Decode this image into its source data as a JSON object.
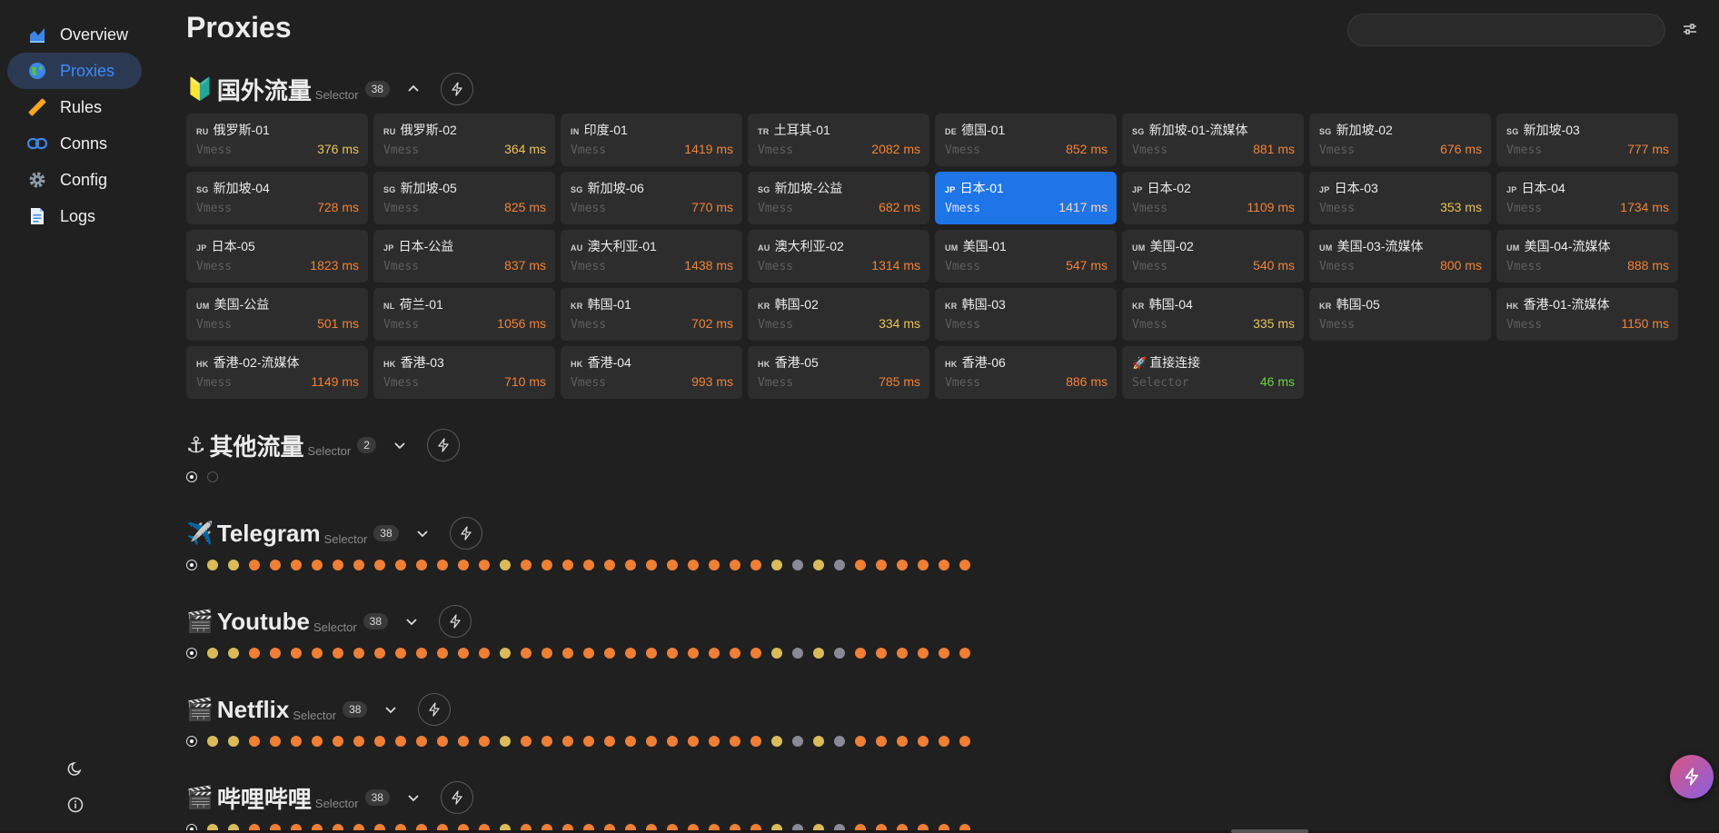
{
  "sidebar": {
    "items": [
      {
        "label": "Overview",
        "icon": "chart-icon"
      },
      {
        "label": "Proxies",
        "icon": "globe-icon"
      },
      {
        "label": "Rules",
        "icon": "ruler-icon"
      },
      {
        "label": "Conns",
        "icon": "link-icon"
      },
      {
        "label": "Config",
        "icon": "gear-icon"
      },
      {
        "label": "Logs",
        "icon": "document-icon"
      }
    ],
    "active": "Proxies"
  },
  "header": {
    "title": "Proxies",
    "search_placeholder": ""
  },
  "groups": [
    {
      "emoji": "🔰",
      "name": "国外流量",
      "type": "Selector",
      "count": "38",
      "expanded": true,
      "proxies": [
        {
          "flag": "RU",
          "name": "俄罗斯-01",
          "proto": "Vmess",
          "latency": "376 ms",
          "level": "mid"
        },
        {
          "flag": "RU",
          "name": "俄罗斯-02",
          "proto": "Vmess",
          "latency": "364 ms",
          "level": "mid"
        },
        {
          "flag": "IN",
          "name": "印度-01",
          "proto": "Vmess",
          "latency": "1419 ms",
          "level": "high"
        },
        {
          "flag": "TR",
          "name": "土耳其-01",
          "proto": "Vmess",
          "latency": "2082 ms",
          "level": "high"
        },
        {
          "flag": "DE",
          "name": "德国-01",
          "proto": "Vmess",
          "latency": "852 ms",
          "level": "high"
        },
        {
          "flag": "SG",
          "name": "新加坡-01-流媒体",
          "proto": "Vmess",
          "latency": "881 ms",
          "level": "high"
        },
        {
          "flag": "SG",
          "name": "新加坡-02",
          "proto": "Vmess",
          "latency": "676 ms",
          "level": "high"
        },
        {
          "flag": "SG",
          "name": "新加坡-03",
          "proto": "Vmess",
          "latency": "777 ms",
          "level": "high"
        },
        {
          "flag": "SG",
          "name": "新加坡-04",
          "proto": "Vmess",
          "latency": "728 ms",
          "level": "high"
        },
        {
          "flag": "SG",
          "name": "新加坡-05",
          "proto": "Vmess",
          "latency": "825 ms",
          "level": "high"
        },
        {
          "flag": "SG",
          "name": "新加坡-06",
          "proto": "Vmess",
          "latency": "770 ms",
          "level": "high"
        },
        {
          "flag": "SG",
          "name": "新加坡-公益",
          "proto": "Vmess",
          "latency": "682 ms",
          "level": "high"
        },
        {
          "flag": "JP",
          "name": "日本-01",
          "proto": "Vmess",
          "latency": "1417 ms",
          "level": "high",
          "selected": true
        },
        {
          "flag": "JP",
          "name": "日本-02",
          "proto": "Vmess",
          "latency": "1109 ms",
          "level": "high"
        },
        {
          "flag": "JP",
          "name": "日本-03",
          "proto": "Vmess",
          "latency": "353 ms",
          "level": "mid"
        },
        {
          "flag": "JP",
          "name": "日本-04",
          "proto": "Vmess",
          "latency": "1734 ms",
          "level": "high"
        },
        {
          "flag": "JP",
          "name": "日本-05",
          "proto": "Vmess",
          "latency": "1823 ms",
          "level": "high"
        },
        {
          "flag": "JP",
          "name": "日本-公益",
          "proto": "Vmess",
          "latency": "837 ms",
          "level": "high"
        },
        {
          "flag": "AU",
          "name": "澳大利亚-01",
          "proto": "Vmess",
          "latency": "1438 ms",
          "level": "high"
        },
        {
          "flag": "AU",
          "name": "澳大利亚-02",
          "proto": "Vmess",
          "latency": "1314 ms",
          "level": "high"
        },
        {
          "flag": "UM",
          "name": "美国-01",
          "proto": "Vmess",
          "latency": "547 ms",
          "level": "high"
        },
        {
          "flag": "UM",
          "name": "美国-02",
          "proto": "Vmess",
          "latency": "540 ms",
          "level": "high"
        },
        {
          "flag": "UM",
          "name": "美国-03-流媒体",
          "proto": "Vmess",
          "latency": "800 ms",
          "level": "high"
        },
        {
          "flag": "UM",
          "name": "美国-04-流媒体",
          "proto": "Vmess",
          "latency": "888 ms",
          "level": "high"
        },
        {
          "flag": "UM",
          "name": "美国-公益",
          "proto": "Vmess",
          "latency": "501 ms",
          "level": "high"
        },
        {
          "flag": "NL",
          "name": "荷兰-01",
          "proto": "Vmess",
          "latency": "1056 ms",
          "level": "high"
        },
        {
          "flag": "KR",
          "name": "韩国-01",
          "proto": "Vmess",
          "latency": "702 ms",
          "level": "high"
        },
        {
          "flag": "KR",
          "name": "韩国-02",
          "proto": "Vmess",
          "latency": "334 ms",
          "level": "mid"
        },
        {
          "flag": "KR",
          "name": "韩国-03",
          "proto": "Vmess",
          "latency": "",
          "level": "none"
        },
        {
          "flag": "KR",
          "name": "韩国-04",
          "proto": "Vmess",
          "latency": "335 ms",
          "level": "mid"
        },
        {
          "flag": "KR",
          "name": "韩国-05",
          "proto": "Vmess",
          "latency": "",
          "level": "none"
        },
        {
          "flag": "HK",
          "name": "香港-01-流媒体",
          "proto": "Vmess",
          "latency": "1150 ms",
          "level": "high"
        },
        {
          "flag": "HK",
          "name": "香港-02-流媒体",
          "proto": "Vmess",
          "latency": "1149 ms",
          "level": "high"
        },
        {
          "flag": "HK",
          "name": "香港-03",
          "proto": "Vmess",
          "latency": "710 ms",
          "level": "high"
        },
        {
          "flag": "HK",
          "name": "香港-04",
          "proto": "Vmess",
          "latency": "993 ms",
          "level": "high"
        },
        {
          "flag": "HK",
          "name": "香港-05",
          "proto": "Vmess",
          "latency": "785 ms",
          "level": "high"
        },
        {
          "flag": "HK",
          "name": "香港-06",
          "proto": "Vmess",
          "latency": "886 ms",
          "level": "high"
        },
        {
          "flag": "🚀",
          "name": "直接连接",
          "proto": "Selector",
          "latency": "46 ms",
          "level": "low"
        }
      ]
    },
    {
      "emoji": "⚓",
      "name": "其他流量",
      "type": "Selector",
      "count": "2",
      "expanded": false,
      "dots": [
        "sel",
        "empty"
      ]
    },
    {
      "emoji": "✈️",
      "name": "Telegram",
      "type": "Selector",
      "count": "38",
      "expanded": false,
      "dots": [
        "sel",
        "y",
        "y",
        "o",
        "o",
        "o",
        "o",
        "o",
        "o",
        "o",
        "o",
        "o",
        "o",
        "o",
        "o",
        "y",
        "o",
        "o",
        "o",
        "o",
        "o",
        "o",
        "o",
        "o",
        "o",
        "o",
        "o",
        "o",
        "y",
        "g",
        "y",
        "g",
        "o",
        "o",
        "o",
        "o",
        "o",
        "o"
      ]
    },
    {
      "emoji": "🎬",
      "name": "Youtube",
      "type": "Selector",
      "count": "38",
      "expanded": false,
      "dots": [
        "sel",
        "y",
        "y",
        "o",
        "o",
        "o",
        "o",
        "o",
        "o",
        "o",
        "o",
        "o",
        "o",
        "o",
        "o",
        "y",
        "o",
        "o",
        "o",
        "o",
        "o",
        "o",
        "o",
        "o",
        "o",
        "o",
        "o",
        "o",
        "y",
        "g",
        "y",
        "g",
        "o",
        "o",
        "o",
        "o",
        "o",
        "o"
      ]
    },
    {
      "emoji": "🎬",
      "name": "Netflix",
      "type": "Selector",
      "count": "38",
      "expanded": false,
      "dots": [
        "sel",
        "y",
        "y",
        "o",
        "o",
        "o",
        "o",
        "o",
        "o",
        "o",
        "o",
        "o",
        "o",
        "o",
        "o",
        "y",
        "o",
        "o",
        "o",
        "o",
        "o",
        "o",
        "o",
        "o",
        "o",
        "o",
        "o",
        "o",
        "y",
        "g",
        "y",
        "g",
        "o",
        "o",
        "o",
        "o",
        "o",
        "o"
      ]
    },
    {
      "emoji": "🎬",
      "name": "哔哩哔哩",
      "type": "Selector",
      "count": "38",
      "expanded": false,
      "dots": [
        "sel",
        "y",
        "y",
        "o",
        "o",
        "o",
        "o",
        "o",
        "o",
        "o",
        "o",
        "o",
        "o",
        "o",
        "o",
        "y",
        "o",
        "o",
        "o",
        "o",
        "o",
        "o",
        "o",
        "o",
        "o",
        "o",
        "o",
        "o",
        "y",
        "g",
        "y",
        "g",
        "o",
        "o",
        "o",
        "o",
        "o",
        "o"
      ]
    }
  ],
  "colors": {
    "accent": "#1f74e8",
    "latency_high": "#f0833a",
    "latency_mid": "#e8c25a",
    "latency_low": "#6ed445"
  }
}
